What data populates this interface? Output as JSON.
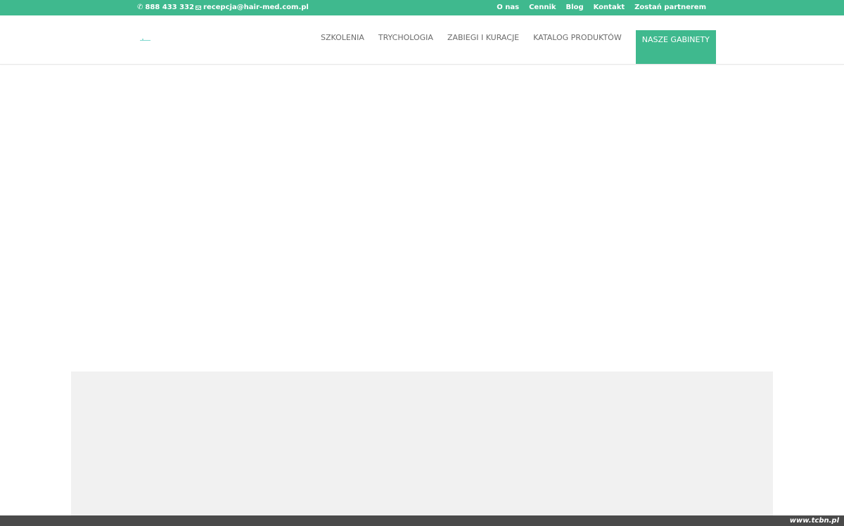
{
  "topbar": {
    "phone_icon": "phone-icon",
    "phone": "888 433 332",
    "email_icon": "envelope-icon",
    "email": "recepcja@hair-med.com.pl",
    "links": [
      "O nas",
      "Cennik",
      "Blog",
      "Kontakt",
      "Zostań partnerem"
    ]
  },
  "header": {
    "nav": [
      "SZKOLENIA",
      "TRYCHOLOGIA",
      "ZABIEGI I KURACJE",
      "KATALOG PRODUKTÓW",
      "NASZE GABINETY"
    ]
  },
  "footer": {
    "watermark": "www.tcbn.pl"
  },
  "colors": {
    "accent": "#3fb98e",
    "panel": "#f1f1f1",
    "footer": "#4a4a4a",
    "nav_text": "#6b6b6b"
  }
}
